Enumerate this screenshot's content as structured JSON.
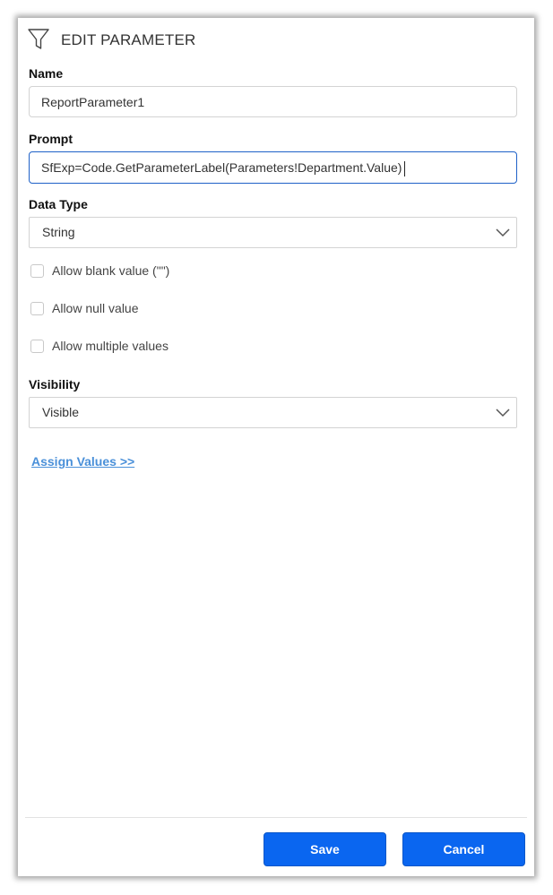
{
  "header": {
    "title": "EDIT PARAMETER",
    "icon": "filter-icon"
  },
  "form": {
    "name": {
      "label": "Name",
      "value": "ReportParameter1"
    },
    "prompt": {
      "label": "Prompt",
      "value": "SfExp=Code.GetParameterLabel(Parameters!Department.Value)"
    },
    "data_type": {
      "label": "Data Type",
      "selected": "String"
    },
    "options": {
      "allow_blank": "Allow blank value (\"\")",
      "allow_null": "Allow null value",
      "allow_multiple": "Allow multiple values"
    },
    "visibility": {
      "label": "Visibility",
      "selected": "Visible"
    },
    "assign_values_link": "Assign Values >>"
  },
  "footer": {
    "save_label": "Save",
    "cancel_label": "Cancel"
  },
  "colors": {
    "primary": "#0a66f0",
    "focus_border": "#1e61c8",
    "link": "#4a90d9"
  }
}
